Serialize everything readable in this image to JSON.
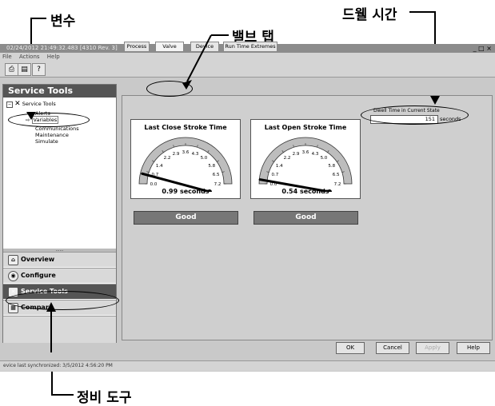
{
  "callouts": {
    "variables": "변수",
    "valve_tab": "밸브 탭",
    "dwell_time": "드웰 시간",
    "service_tools": "정비 도구"
  },
  "window": {
    "title": "02/24/2012 21:49:32.483 [4310 Rev. 3]",
    "controls": "_ □ ×"
  },
  "menu": [
    "File",
    "Actions",
    "Help"
  ],
  "toolbar": {
    "print_icon": "print-icon",
    "preview_icon": "print-preview-icon",
    "help_icon": "help-pointer-icon"
  },
  "left_pane": {
    "header": "Service Tools",
    "tree": {
      "root": "Service Tools",
      "items": [
        "Alerts",
        "Variables",
        "Communications",
        "Maintenance",
        "Simulate"
      ]
    },
    "nav": [
      "Overview",
      "Configure",
      "Service Tools",
      "Compare"
    ]
  },
  "tabs": [
    "Process",
    "Valve",
    "Device",
    "Run Time Extremes"
  ],
  "dwell": {
    "label": "Dwell Time in Current State",
    "value": "151",
    "unit": "seconds"
  },
  "gauges": [
    {
      "title": "Last Close Stroke Time",
      "ticks": [
        "0.0",
        "0.7",
        "1.4",
        "2.2",
        "2.9",
        "3.6",
        "4.3",
        "5.0",
        "5.8",
        "6.5",
        "7.2"
      ],
      "value": 0.99,
      "value_text": "0.99 seconds",
      "status": "Good"
    },
    {
      "title": "Last Open Stroke Time",
      "ticks": [
        "0.0",
        "0.7",
        "1.4",
        "2.2",
        "2.9",
        "3.6",
        "4.3",
        "5.0",
        "5.8",
        "6.5",
        "7.2"
      ],
      "value": 0.54,
      "value_text": "0.54 seconds",
      "status": "Good"
    }
  ],
  "buttons": {
    "ok": "OK",
    "cancel": "Cancel",
    "apply": "Apply",
    "help": "Help"
  },
  "statusbar": "evice last synchronized: 3/5/2012 4:56:20 PM",
  "colors": {
    "status_good": "#777777",
    "pane_header": "#555555"
  }
}
